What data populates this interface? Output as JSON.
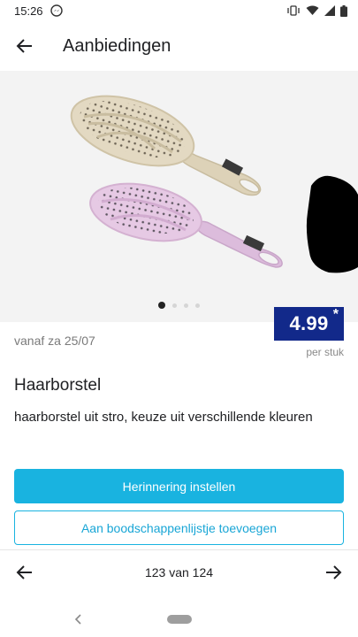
{
  "status_bar": {
    "time": "15:26"
  },
  "app_bar": {
    "title": "Aanbiedingen"
  },
  "carousel": {
    "count": 4,
    "active_index": 0
  },
  "offer": {
    "valid_from": "vanaf za 25/07",
    "price": "4.99",
    "price_mark": "*",
    "unit": "per stuk",
    "title": "Haarborstel",
    "description": "haarborstel uit stro, keuze uit verschillende kleuren"
  },
  "actions": {
    "reminder_label": "Herinnering instellen",
    "add_list_label": "Aan boodschappenlijstje toevoegen"
  },
  "pager": {
    "label": "123 van 124"
  },
  "colors": {
    "price_bg": "#12298a",
    "accent": "#19b3e0",
    "hero_bg": "#f3f3f3"
  }
}
